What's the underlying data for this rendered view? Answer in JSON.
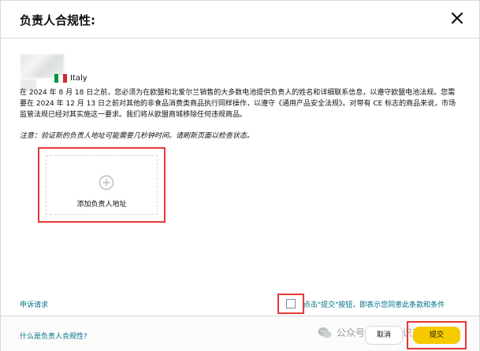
{
  "dialog": {
    "title": "负责人合规性:",
    "close_icon": "close-icon"
  },
  "seller": {
    "country": "Italy",
    "flag_colors": [
      "#009246",
      "#ffffff",
      "#ce2b37"
    ]
  },
  "notice": {
    "text": "在 2024 年 8 月 18 日之前，您必须为在欧盟和北爱尔兰销售的大多数电池提供负责人的姓名和详细联系信息，以遵守欧盟电池法规。您需要在 2024 年 12 月 13 日之前对其他的非食品消费类商品执行同样操作，以遵守《通用产品安全法规》。对带有 CE 标志的商品来说，市场监管法规已经对其实施这一要求。我们将从欧盟商城移除任何违规商品。",
    "note": "注意：验证新的负责人地址可能需要几秒钟时间。请刷新页面以检查状态。"
  },
  "add_card": {
    "label": "添加负责人地址",
    "icon": "plus-circle-icon"
  },
  "links": {
    "appeal": "申诉请求",
    "help": "什么是负责人合规性?"
  },
  "agreement": {
    "text": "点击\"提交\"按钮，即表示您同意此条款和条件",
    "checked": false
  },
  "buttons": {
    "cancel": "取消",
    "submit": "提交"
  },
  "watermark": {
    "text": "公众号 · 多半知识产权",
    "icon": "wechat-icon"
  },
  "colors": {
    "accent_link": "#007185",
    "submit_yellow": "#f7ca00",
    "highlight_red": "#e53935"
  }
}
